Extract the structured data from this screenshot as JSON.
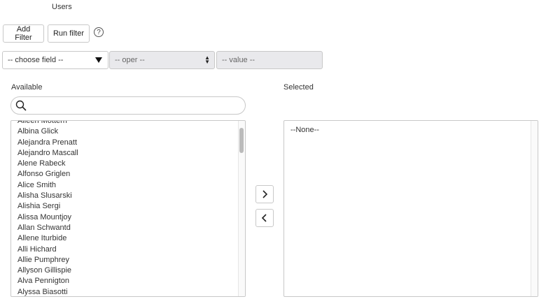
{
  "header": {
    "title": "Users"
  },
  "toolbar": {
    "add_filter_label": "Add Filter",
    "run_filter_label": "Run filter",
    "help_glyph": "?"
  },
  "filter": {
    "field_placeholder": "-- choose field --",
    "oper_placeholder": "-- oper --",
    "value_placeholder": "-- value --"
  },
  "available": {
    "label": "Available",
    "search_value": "",
    "items": [
      "Aileen Mottern",
      "Albina Glick",
      "Alejandra Prenatt",
      "Alejandro Mascall",
      "Alene Rabeck",
      "Alfonso Griglen",
      "Alice Smith",
      "Alisha Slusarski",
      "Alishia Sergi",
      "Alissa Mountjoy",
      "Allan Schwantd",
      "Allene Iturbide",
      "Alli Hichard",
      "Allie Pumphrey",
      "Allyson Gillispie",
      "Alva Pennigton",
      "Alyssa Biasotti"
    ]
  },
  "selected": {
    "label": "Selected",
    "items": [
      "--None--"
    ]
  },
  "icons": {
    "search": "search-icon",
    "move_right": "chevron-right-icon",
    "move_left": "chevron-left-icon",
    "help": "help-circle-icon",
    "dropdown": "caret-down-icon"
  }
}
